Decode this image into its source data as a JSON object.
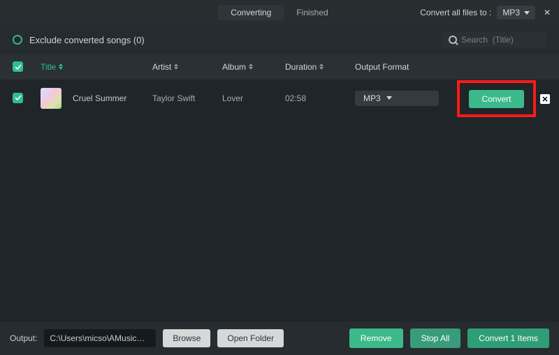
{
  "topbar": {
    "tab_converting": "Converting",
    "tab_finished": "Finished",
    "convert_all_label": "Convert all files to :",
    "global_format": "MP3"
  },
  "subbar": {
    "exclude_label": "Exclude converted songs (0)",
    "search_placeholder": "Search  (Title)"
  },
  "columns": {
    "title": "Title",
    "artist": "Artist",
    "album": "Album",
    "duration": "Duration",
    "output_format": "Output Format"
  },
  "rows": [
    {
      "checked": true,
      "title": "Cruel Summer",
      "artist": "Taylor Swift",
      "album": "Lover",
      "duration": "02:58",
      "format": "MP3",
      "convert_label": "Convert"
    }
  ],
  "bottom": {
    "output_label": "Output:",
    "output_path": "C:\\Users\\micso\\AMusicSoft\\...",
    "browse": "Browse",
    "open_folder": "Open Folder",
    "remove": "Remove",
    "stop_all": "Stop All",
    "convert_items": "Convert 1 Items"
  }
}
